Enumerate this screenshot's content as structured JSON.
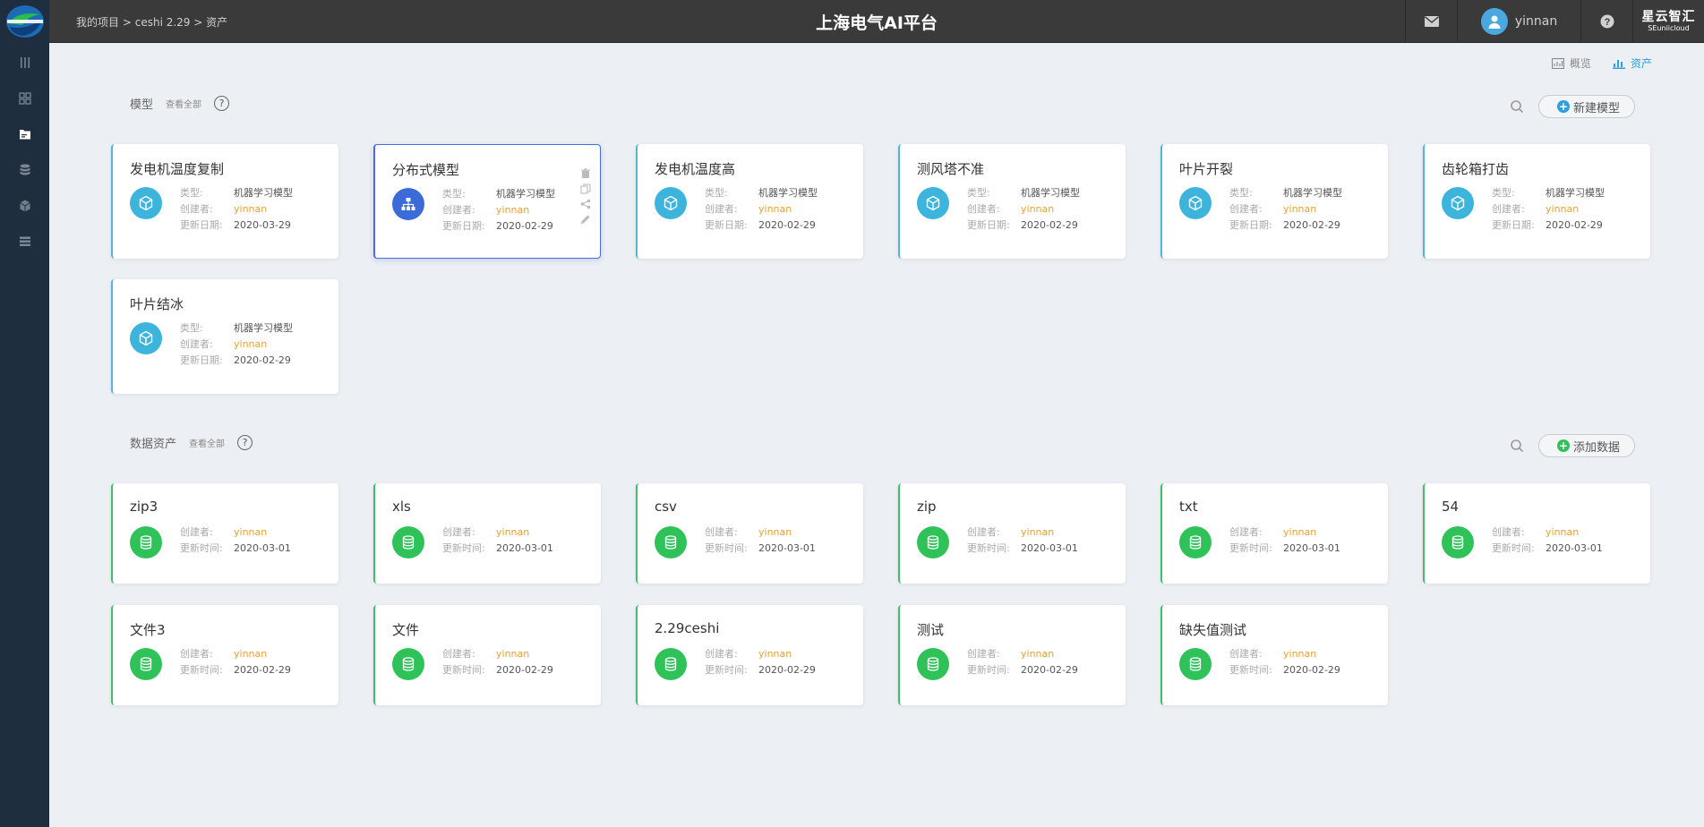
{
  "header": {
    "breadcrumb": [
      "我的项目",
      "ceshi 2.29",
      "资产"
    ],
    "separator": ">",
    "title": "上海电气AI平台",
    "user": "yinnan",
    "brand_cn": "星云智汇",
    "brand_en": "SEuniicloud"
  },
  "view_toggle": {
    "overview": "概览",
    "assets": "资产"
  },
  "models_section": {
    "title": "模型",
    "view_all": "查看全部",
    "help": "?",
    "new_button": "新建模型",
    "labels": {
      "type": "类型:",
      "creator": "创建者:",
      "updated": "更新日期:"
    },
    "cards": [
      {
        "title": "发电机温度复制",
        "type": "机器学习模型",
        "creator": "yinnan",
        "date": "2020-03-29"
      },
      {
        "title": "分布式模型",
        "type": "机器学习模型",
        "creator": "yinnan",
        "date": "2020-02-29"
      },
      {
        "title": "发电机温度高",
        "type": "机器学习模型",
        "creator": "yinnan",
        "date": "2020-02-29"
      },
      {
        "title": "测风塔不准",
        "type": "机器学习模型",
        "creator": "yinnan",
        "date": "2020-02-29"
      },
      {
        "title": "叶片开裂",
        "type": "机器学习模型",
        "creator": "yinnan",
        "date": "2020-02-29"
      },
      {
        "title": "齿轮箱打齿",
        "type": "机器学习模型",
        "creator": "yinnan",
        "date": "2020-02-29"
      },
      {
        "title": "叶片结冰",
        "type": "机器学习模型",
        "creator": "yinnan",
        "date": "2020-02-29"
      }
    ]
  },
  "data_section": {
    "title": "数据资产",
    "view_all": "查看全部",
    "help": "?",
    "add_button": "添加数据",
    "labels": {
      "creator": "创建者:",
      "updated": "更新时间:"
    },
    "cards": [
      {
        "title": "zip3",
        "creator": "yinnan",
        "date": "2020-03-01"
      },
      {
        "title": "xls",
        "creator": "yinnan",
        "date": "2020-03-01"
      },
      {
        "title": "csv",
        "creator": "yinnan",
        "date": "2020-03-01"
      },
      {
        "title": "zip",
        "creator": "yinnan",
        "date": "2020-03-01"
      },
      {
        "title": "txt",
        "creator": "yinnan",
        "date": "2020-03-01"
      },
      {
        "title": "54",
        "creator": "yinnan",
        "date": "2020-03-01"
      },
      {
        "title": "文件3",
        "creator": "yinnan",
        "date": "2020-02-29"
      },
      {
        "title": "文件",
        "creator": "yinnan",
        "date": "2020-02-29"
      },
      {
        "title": "2.29ceshi",
        "creator": "yinnan",
        "date": "2020-02-29"
      },
      {
        "title": "测试",
        "creator": "yinnan",
        "date": "2020-02-29"
      },
      {
        "title": "缺失值测试",
        "creator": "yinnan",
        "date": "2020-02-29"
      }
    ]
  },
  "colors": {
    "sidebar": "#1f2e3f",
    "header": "#3a3a3a",
    "model_accent": "#3cb4dc",
    "data_accent": "#2fc259",
    "creator": "#e6a12e",
    "active_link": "#2d9fe0"
  }
}
